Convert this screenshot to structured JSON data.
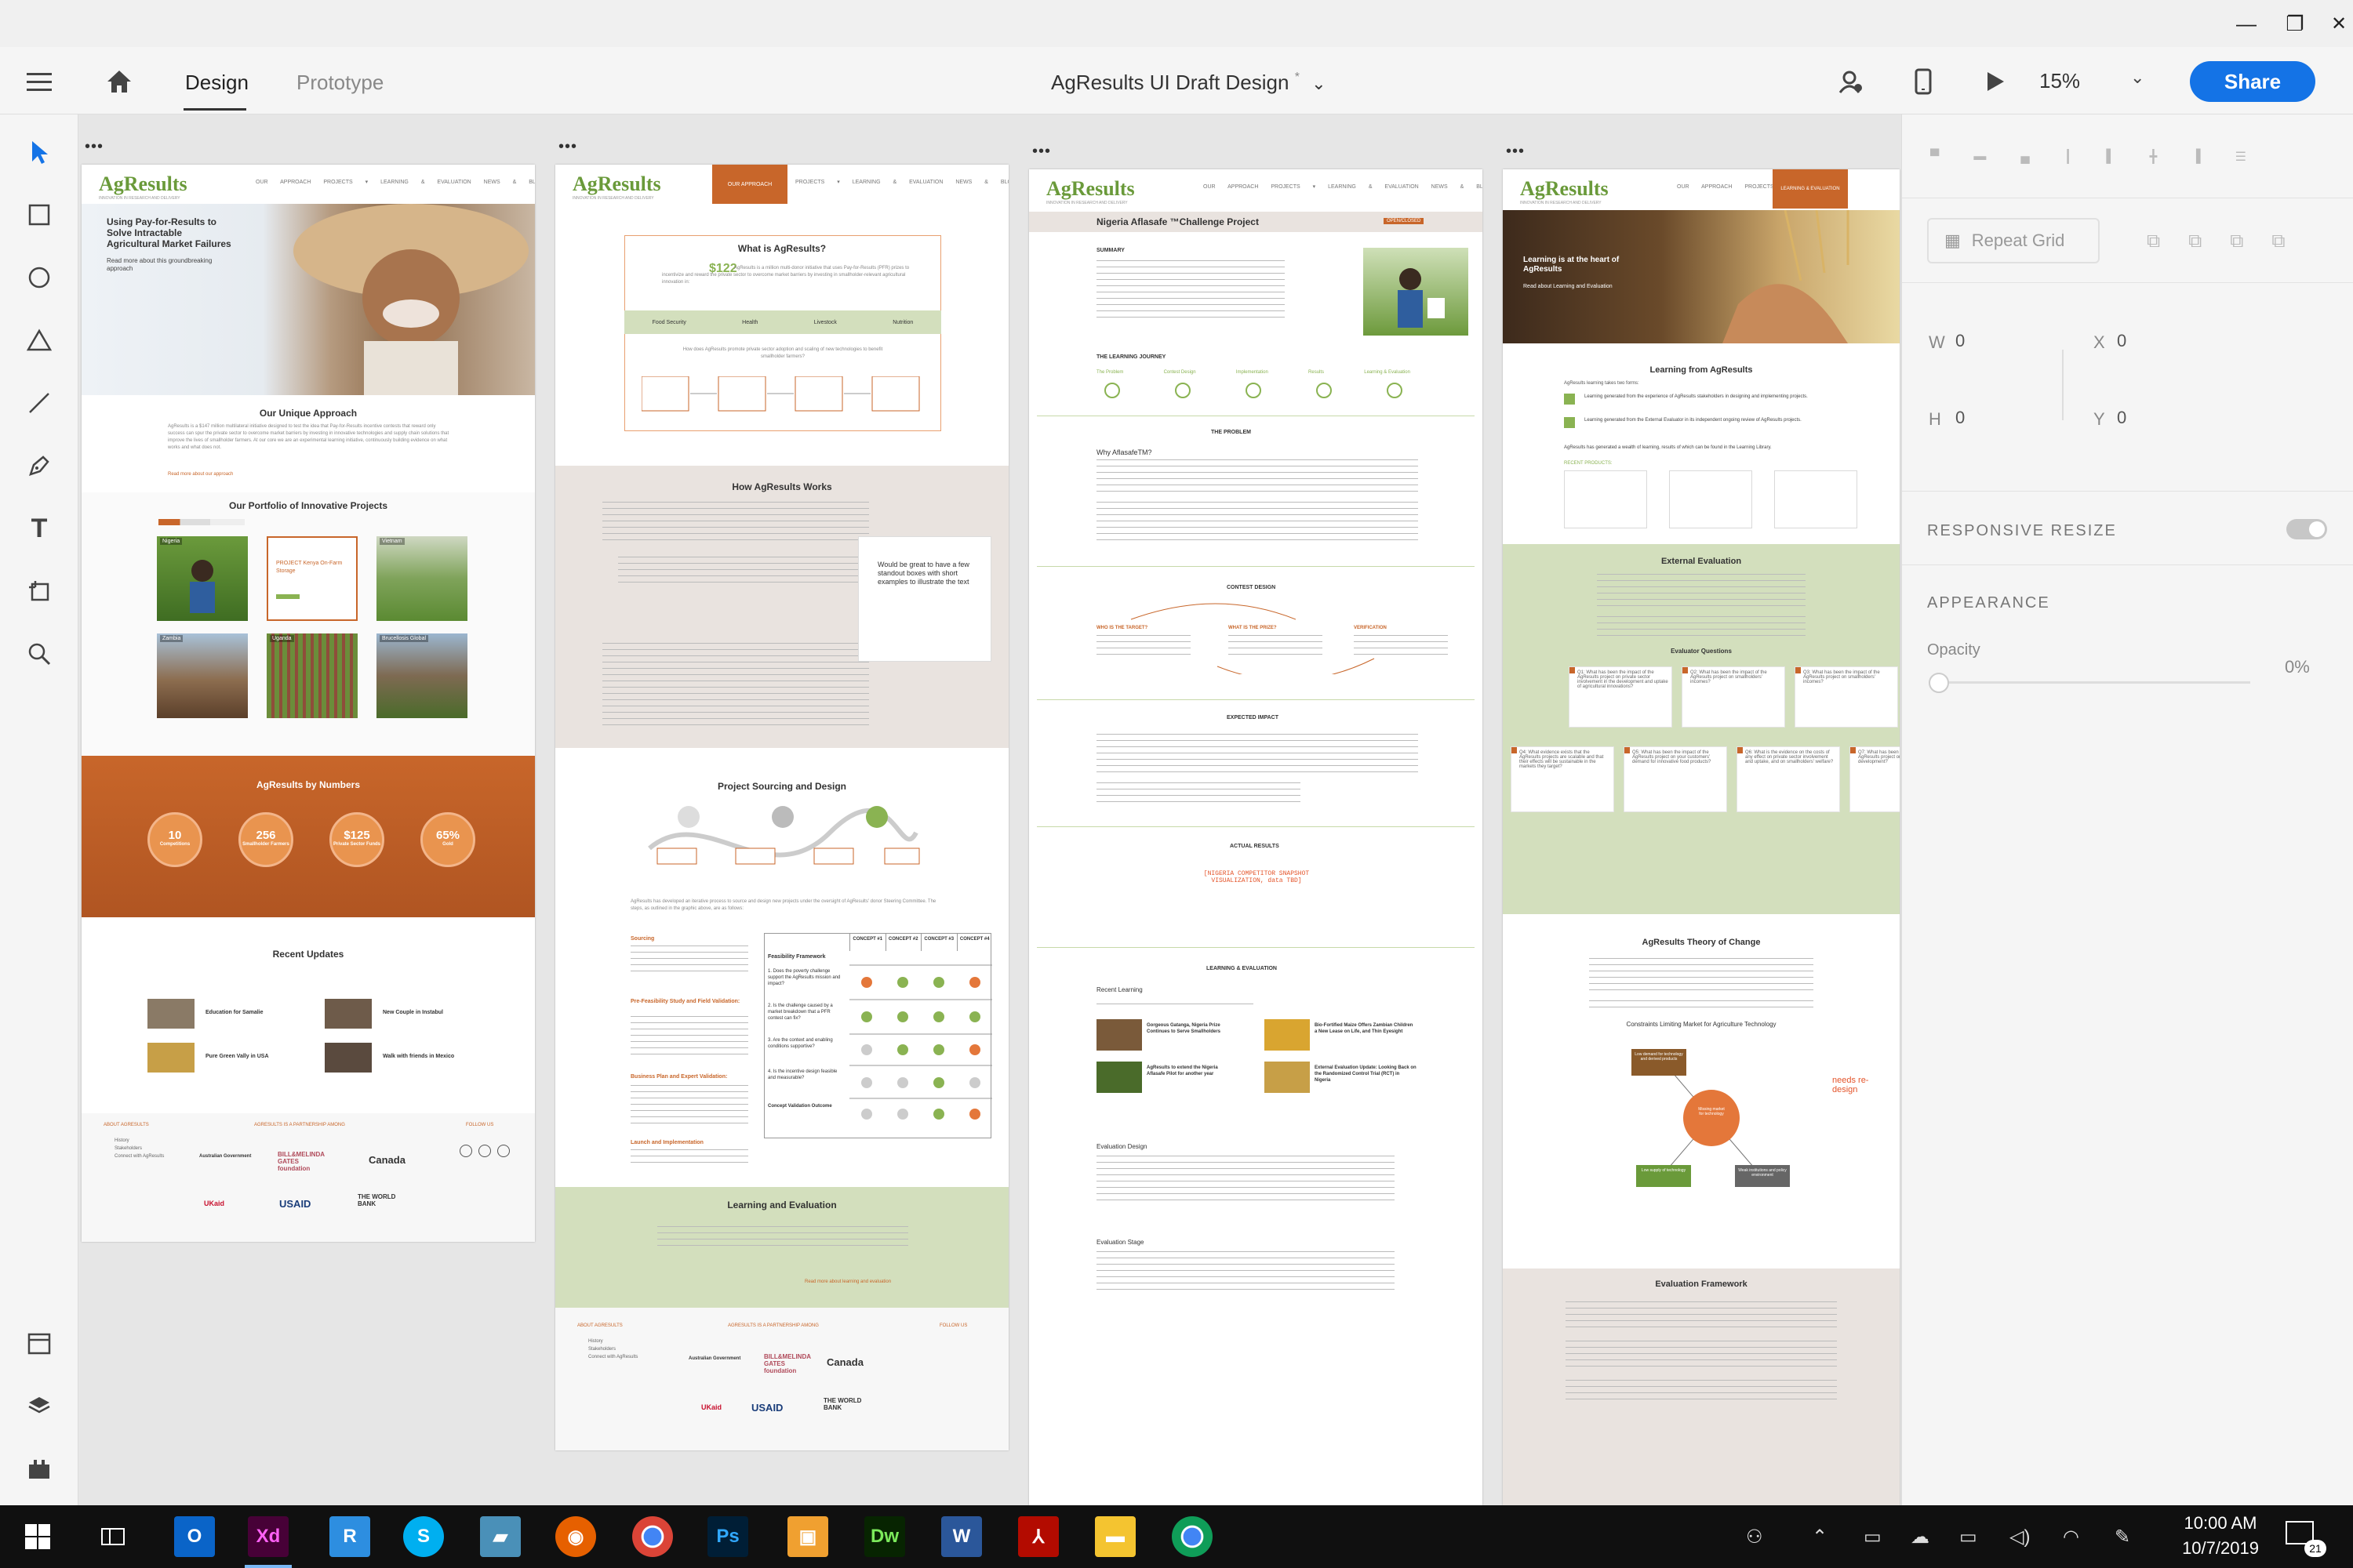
{
  "window": {
    "minimize": "—",
    "maximize": "❐",
    "close": "✕"
  },
  "app": {
    "tabs": [
      "Design",
      "Prototype"
    ],
    "doc_title": "AgResults UI Draft Design",
    "doc_modified_mark": "*",
    "zoom": "15%",
    "share": "Share",
    "accent": "#1473e6"
  },
  "tools": [
    "select-arrow-icon",
    "rectangle-icon",
    "ellipse-icon",
    "triangle-icon",
    "line-icon",
    "pen-icon",
    "text-icon",
    "artboard-icon",
    "zoom-icon",
    "assets-icon",
    "layers-icon",
    "plugins-icon"
  ],
  "panel": {
    "repeat_grid": "Repeat Grid",
    "w_label": "W",
    "w_val": "0",
    "x_label": "X",
    "x_val": "0",
    "h_label": "H",
    "h_val": "0",
    "y_label": "Y",
    "y_val": "0",
    "responsive_resize": "RESPONSIVE RESIZE",
    "appearance": "APPEARANCE",
    "opacity_label": "Opacity",
    "opacity_val": "0%"
  },
  "site": {
    "logo": "AgResults",
    "logo_sub": "INNOVATION IN RESEARCH AND DELIVERY",
    "nav": "OUR APPROACH PROJECTS ▾ LEARNING & EVALUATION NEWS & BLOG ABOUT ▾",
    "nav_active_1": "OUR APPROACH",
    "nav_active_3": "LEARNING & EVALUATION"
  },
  "ab1": {
    "hero_title": "Using Pay-for-Results to Solve Intractable Agricultural Market Failures",
    "hero_link": "Read more about this groundbreaking approach",
    "approach_title": "Our Unique Approach",
    "approach_text": "AgResults is a $147 million multilateral initiative designed to test the idea that Pay-for-Results incentive contests that reward only success can spur the private sector to overcome market barriers by investing in innovative technologies and supply chain solutions that improve the lives of smallholder farmers. At our core we are an experimental learning initiative, continuously building evidence on what works and what does not.",
    "approach_link": "Read more about our approach",
    "portfolio_title": "Our Portfolio of Innovative Projects",
    "tiles": [
      "Nigeria",
      "PROJECT Kenya On-Farm Storage",
      "Vietnam",
      "Zambia",
      "Uganda",
      "Brucellosis Global"
    ],
    "numbers_title": "AgResults by Numbers",
    "numbers": [
      {
        "n": "10",
        "l": "Competitions"
      },
      {
        "n": "256",
        "l": "Smallholder Farmers"
      },
      {
        "n": "$125",
        "l": "Private Sector Funds"
      },
      {
        "n": "65%",
        "l": "Gold"
      }
    ],
    "updates_title": "Recent Updates",
    "updates": [
      "Education for Samalie",
      "New Couple in Instabul",
      "Pure Green Vally in USA",
      "Walk with friends in Mexico"
    ],
    "footer_about": "ABOUT AGRESULTS",
    "footer_links": [
      "History",
      "Stakeholders",
      "Connect with AgResults"
    ],
    "footer_partner": "AGRESULTS IS A PARTNERSHIP AMONG",
    "footer_follow": "FOLLOW US",
    "partners": [
      "Australian Government",
      "BILL&MELINDA GATES foundation",
      "Canada",
      "UKaid",
      "USAID",
      "THE WORLD BANK"
    ]
  },
  "ab2": {
    "what_title": "What is AgResults?",
    "what_amount": "$122",
    "what_text": "AgResults is a million multi-donor initiative that uses Pay-for-Results (PFR) prizes to incentivize and reward the private sector to overcome market barriers by investing in smallholder-relevant agricultural innovation in:",
    "sectors": [
      "Food Security",
      "Health",
      "Livestock",
      "Nutrition"
    ],
    "how_q": "How does AgResults promote private sector adoption and scaling of new technologies to benefit smallholder farmers?",
    "works_title": "How AgResults Works",
    "note": "Would be great to have a few standout boxes with short examples to illustrate the text",
    "sourcing_title": "Project Sourcing and Design",
    "sourcing_text": "AgResults has developed an iterative process to source and design new projects under the oversight of AgResults' donor Steering Committee. The steps, as outlined in the graphic above, are as follows:",
    "steps": [
      "Sourcing",
      "Pre-Feasibility Study and Field Validation:",
      "Business Plan and Expert Validation:",
      "Launch and Implementation"
    ],
    "table_headers": [
      "CONCEPT #1",
      "CONCEPT #2",
      "CONCEPT #3",
      "CONCEPT #4"
    ],
    "table_title": "Feasibility Framework",
    "table_rows": [
      "1. Does the poverty challenge support the AgResults mission and impact?",
      "2. Is the challenge caused by a market breakdown that a PFR contest can fix?",
      "3. Are the context and enabling conditions supportive?",
      "4. Is the incentive design feasible and measurable?",
      "Concept Validation Outcome"
    ],
    "le_title": "Learning and Evaluation",
    "le_link": "Read more about learning and evaluation"
  },
  "ab3": {
    "title": "Nigeria Aflasafe ™Challenge Project",
    "badge": "OPEN/CLOSED",
    "summary": "SUMMARY",
    "journey": "THE LEARNING JOURNEY",
    "journey_steps": [
      "The Problem",
      "Contest Design",
      "Implementation",
      "Results",
      "Learning & Evaluation"
    ],
    "problem": "THE PROBLEM",
    "why": "Why AflasafeTM?",
    "contest": "CONTEST DESIGN",
    "target": "WHO IS THE TARGET?",
    "prize": "WHAT IS THE PRIZE?",
    "verification": "VERIFICATION",
    "impact": "EXPECTED IMPACT",
    "actual": "ACTUAL RESULTS",
    "snapshot": "[NIGERIA COMPETITOR SNAPSHOT VISUALIZATION, data TBD]",
    "le": "LEARNING & EVALUATION",
    "recent": "Recent Learning",
    "learning_items": [
      "Gorgeous Gatanga, Nigeria Prize Continues to Serve Smallholders",
      "Bio-Fortified Maize Offers Zambian Children a New Lease on Life, and Thin Eyesight",
      "AgResults to extend the Nigeria Aflasafe Pilot for another year",
      "External Evaluation Update: Looking Back on the Randomized Control Trial (RCT) in Nigeria"
    ],
    "eval_design": "Evaluation Design",
    "eval_stage": "Evaluation Stage"
  },
  "ab4": {
    "hero_title": "Learning is at the heart of AgResults",
    "hero_link": "Read about Learning and Evaluation",
    "learning_title": "Learning from AgResults",
    "learning_intro": "AgResults learning takes two forms:",
    "forms": [
      "Learning generated from the experience of AgResults stakeholders in designing and implementing projects.",
      "Learning generated from the External Evaluator in its independent ongoing review of AgResults projects."
    ],
    "wealth": "AgResults has generated a wealth of learning, results of which can be found in the Learning Library.",
    "recent_products": "RECENT PRODUCTS:",
    "ext_title": "External Evaluation",
    "eval_q": "Evaluator Questions",
    "questions": [
      "Q1: What has been the impact of the AgResults project on private sector involvement in the development and uptake of agricultural innovations?",
      "Q2: What has been the impact of the AgResults project on smallholders' incomes?",
      "Q3: What has been the impact of the AgResults project on smallholders' incomes?",
      "Q4: What evidence exists that the AgResults projects are scalable and that their effects will be sustainable in the markets they target?",
      "Q5: What has been the impact of the AgResults project on your customers' demand for innovative food products?",
      "Q6: What is the evidence on the costs of any effect on private sector involvement and uptake, and on smallholders' welfare?",
      "Q7: What has been the impact of the AgResults project on food and development?"
    ],
    "toc_title": "AgResults Theory of Change",
    "constraints": "Constraints Limiting Market for Agriculture Technology",
    "toc_nodes": [
      "Low demand for technology and derived products",
      "Missing market for technology",
      "Low supply of technology",
      "Weak institutions and policy environment"
    ],
    "toc_note": "needs re-design",
    "eval_fw": "Evaluation Framework"
  },
  "taskbar": {
    "apps": [
      "start-icon",
      "task-view-icon",
      "outlook-icon",
      "xd-icon",
      "notes-icon",
      "skype-icon",
      "files-icon",
      "firefox-icon",
      "chrome-icon",
      "photoshop-icon",
      "gif-icon",
      "dreamweaver-icon",
      "word-icon",
      "pdf-icon",
      "explorer-icon",
      "chrome-2-icon"
    ],
    "time": "10:00 AM",
    "date": "10/7/2019",
    "notif": "21"
  }
}
